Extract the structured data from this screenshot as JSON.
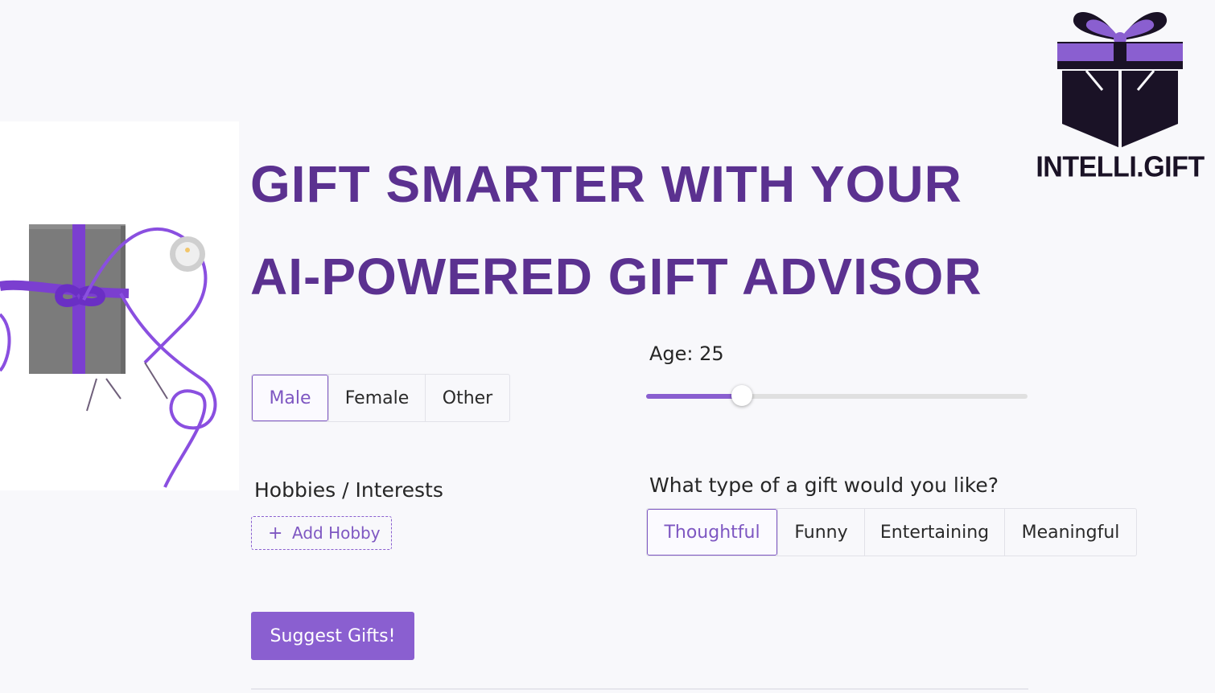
{
  "brand": {
    "name": "INTELLI.GIFT",
    "logo_icon": "gift-box-icon",
    "colors": {
      "box": "#1a1226",
      "ribbon": "#8a5fd0"
    }
  },
  "hero": {
    "headline": "Gift smarter with your AI-powered gift advisor",
    "image": "gift-box-with-purple-ribbon"
  },
  "gender": {
    "options": [
      "Male",
      "Female",
      "Other"
    ],
    "selected": "Male"
  },
  "age": {
    "label": "Age: 25",
    "value": 25,
    "fill_fraction": 0.25
  },
  "hobbies": {
    "label": "Hobbies / Interests",
    "add_label": "Add Hobby",
    "add_icon": "plus-icon"
  },
  "gift_type": {
    "question": "What type of a gift would you like?",
    "options": [
      "Thoughtful",
      "Funny",
      "Entertaining",
      "Meaningful"
    ],
    "selected": "Thoughtful"
  },
  "actions": {
    "suggest_label": "Suggest Gifts!"
  },
  "colors": {
    "accent": "#8a5fd0",
    "headline": "#5b3190",
    "background": "#f8f8fb"
  }
}
